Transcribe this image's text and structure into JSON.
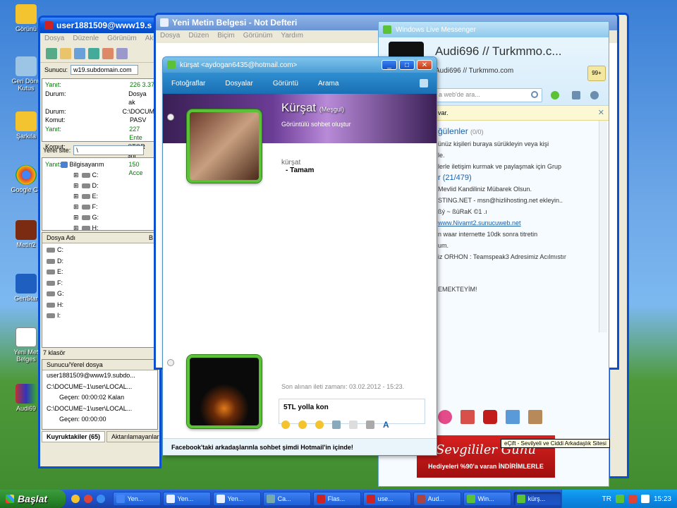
{
  "desktop": {
    "icons": [
      "Görünü",
      "Geri Dönü Kutus",
      "Şarkıla",
      "Google Ch",
      "Metin2",
      "GenStar",
      "Yeni Met Belges",
      "Audi69"
    ]
  },
  "ftp": {
    "title": "user1881509@www19.s",
    "menu": [
      "Dosya",
      "Düzenle",
      "Görünüm",
      "Akt"
    ],
    "server_label": "Sunucu:",
    "server_value": "w19.subdomain.com",
    "log": [
      {
        "k": "Yanıt:",
        "v": "226 3.37",
        "green": true
      },
      {
        "k": "Durum:",
        "v": "Dosya ak",
        "green": false
      },
      {
        "k": "Durum:",
        "v": "C:\\DOCUM",
        "green": false
      },
      {
        "k": "Komut:",
        "v": "PASV",
        "green": false
      },
      {
        "k": "Yanıt:",
        "v": "227 Ente",
        "green": true
      },
      {
        "k": "Komut:",
        "v": "STOR sni",
        "green": false
      },
      {
        "k": "Yanıt:",
        "v": "150 Acce",
        "green": true
      }
    ],
    "local_site_label": "Yerel site:",
    "local_site_value": "\\",
    "tree_root": "Bilgisayarım",
    "tree": [
      "C:",
      "D:",
      "E:",
      "F:",
      "G:",
      "H:"
    ],
    "col_name": "Dosya Adı",
    "col_b": "B",
    "files": [
      "C:",
      "D:",
      "E:",
      "F:",
      "G:",
      "H:",
      "I:"
    ],
    "folder_count": "7 klasör",
    "queue_header": "Sunucu/Yerel dosya",
    "queue": [
      "user1881509@www19.subdo...",
      "C:\\DOCUME~1\\user\\LOCAL...",
      "Geçen: 00:00:02     Kalan",
      "C:\\DOCUME~1\\user\\LOCAL...",
      "Geçen: 00:00:00"
    ],
    "tabs": [
      "Kuyruktakiler (65)",
      "Aktarılamayanlar",
      "Aktarılanlar (31)"
    ]
  },
  "notepad": {
    "title": "Yeni Metin Belgesi - Not Defteri",
    "menu": [
      "Dosya",
      "Düzen",
      "Biçim",
      "Görünüm",
      "Yardım"
    ]
  },
  "chat": {
    "title": "kürşat <aydogan6435@hotmail.com>",
    "toolbar": [
      "Fotoğraflar",
      "Dosyalar",
      "Görüntü",
      "Arama"
    ],
    "contact_name": "Kürşat",
    "contact_status": "(Meşgul)",
    "contact_subtitle": "Görüntülü sohbet oluştur",
    "msg_sender": "kürşat",
    "msg_text": "Tamam",
    "last_received": "Son alınan ileti zamanı: 03.02.2012 - 15:23.",
    "input_text": "5TL yolla kon",
    "footer": "Facebook'taki arkadaşlarınla sohbet şimdi Hotmail'in içinde!"
  },
  "wlm": {
    "title": "Windows Live Messenger",
    "user_name": "Audi696 // Turkmmo.c...",
    "user_sub": "Audi696 // Turkmmo.com",
    "search_placeholder": "a web'de ara...",
    "info_bar": "var.",
    "group_title": "ğülenler",
    "group_count": "(0/0)",
    "rows": [
      "ünüz kişileri buraya sürükleyin veya kişi",
      "le.",
      "lerle iletişim kurmak ve paylaşmak için Grup",
      "r (21/479)",
      "Mevlid Kandiliniz Mübarek Olsun.",
      "STING.NET - msn@hizlihosting.net ekleyin..",
      "ßý ~ ßüRaK ©1 .ı",
      "www.Nivamt2.sunucuweb.net",
      "n waar internette 10dk sonra titretin",
      "um.",
      "iz ORHON : Teamspeak3 Adresimiz Acılmıstır",
      "EMEKTEYİM!"
    ],
    "ad_line1": "Sevgililer Günü",
    "ad_line2": "Hediyeleri %90'a varan İNDİRİMLERLE",
    "tooltip": "eÇift - Sevilyeli ve Ciddi Arkadaşlık Sitesi",
    "counter": "99+"
  },
  "taskbar": {
    "start": "Başlat",
    "buttons": [
      "Yen...",
      "Yen...",
      "Yen...",
      "Ca...",
      "Flas...",
      "use...",
      "Aud...",
      "Win...",
      "kürş..."
    ],
    "lang": "TR",
    "clock": "15:23"
  }
}
